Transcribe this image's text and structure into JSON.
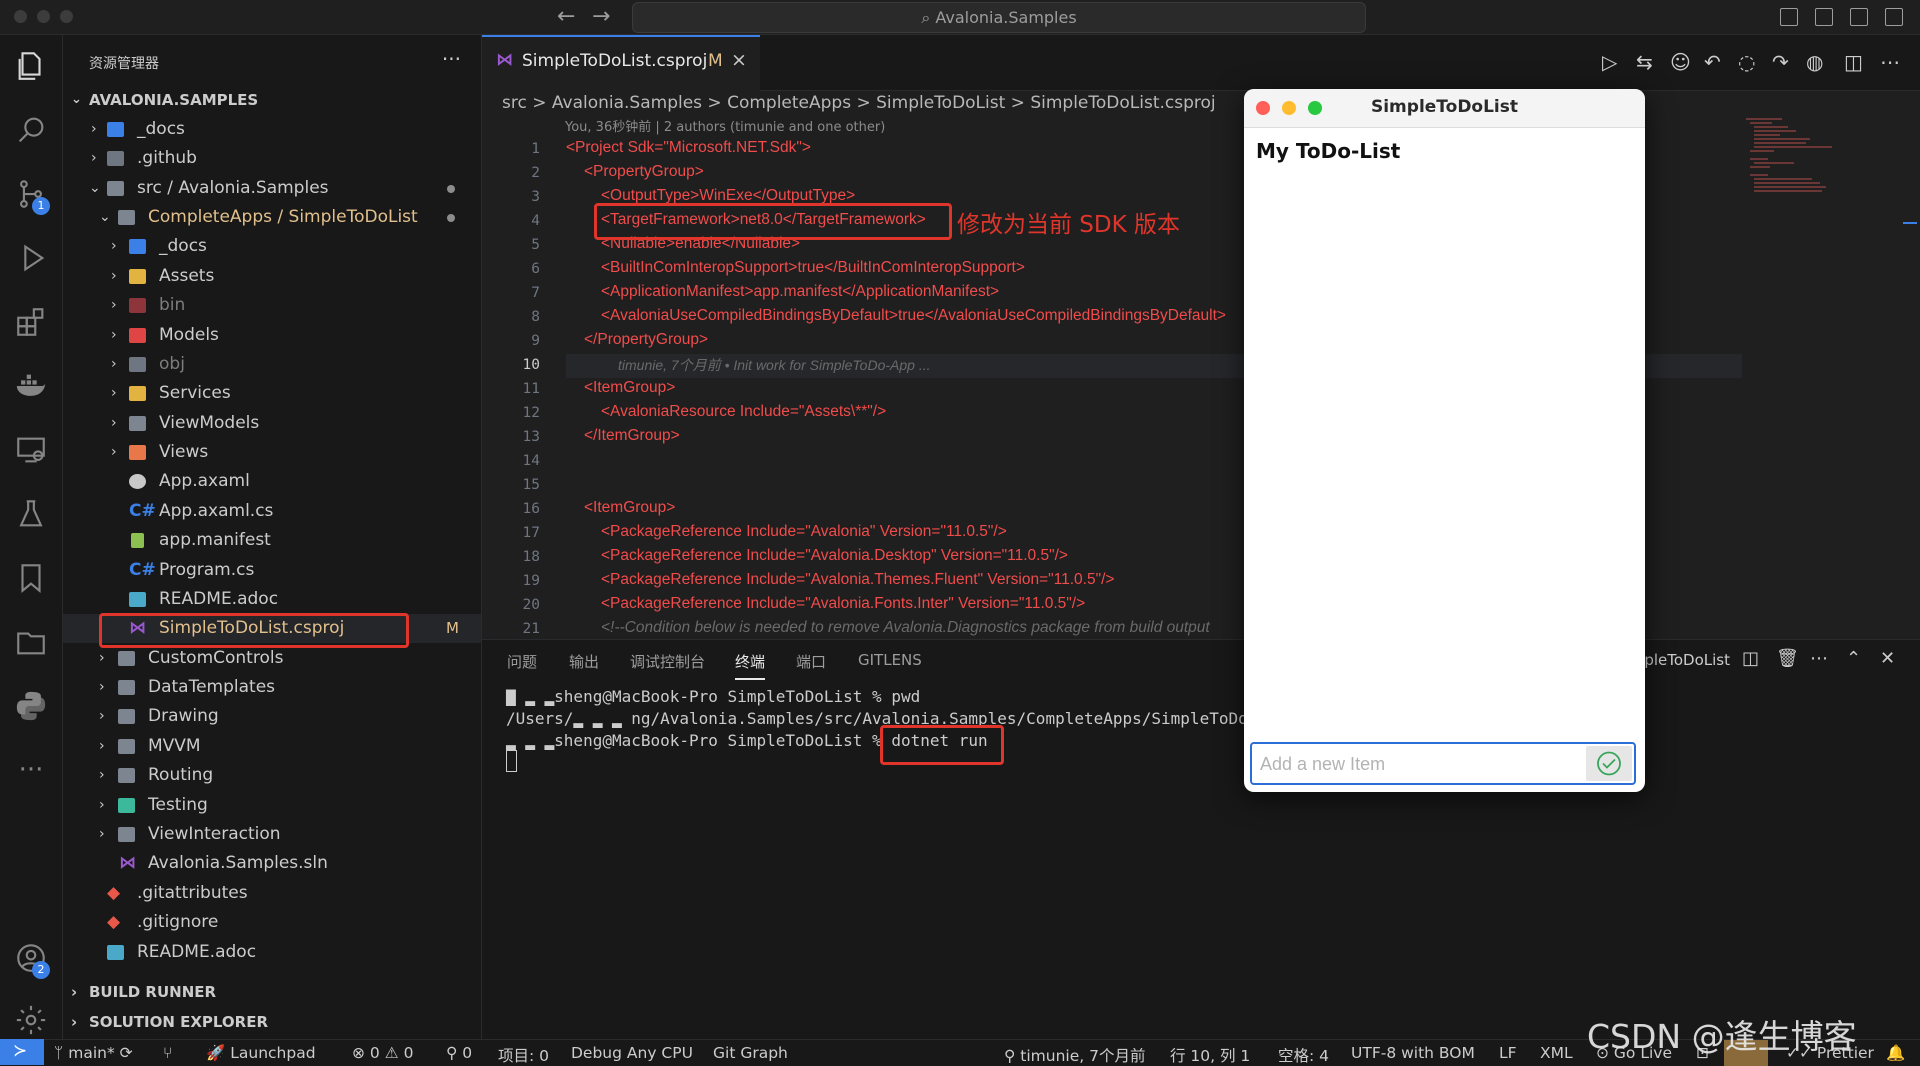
{
  "titlebar": {
    "search_text": "Avalonia.Samples"
  },
  "activity": {
    "scm_badge": "1",
    "accounts_badge": "2"
  },
  "sidebar": {
    "title": "资源管理器",
    "more": "···",
    "root": "AVALONIA.SAMPLES",
    "items": [
      {
        "label": "_docs"
      },
      {
        "label": ".github"
      },
      {
        "label": "src / Avalonia.Samples"
      },
      {
        "label": "CompleteApps / SimpleToDoList"
      },
      {
        "label": "_docs"
      },
      {
        "label": "Assets"
      },
      {
        "label": "bin"
      },
      {
        "label": "Models"
      },
      {
        "label": "obj"
      },
      {
        "label": "Services"
      },
      {
        "label": "ViewModels"
      },
      {
        "label": "Views"
      },
      {
        "label": "App.axaml"
      },
      {
        "label": "App.axaml.cs"
      },
      {
        "label": "app.manifest"
      },
      {
        "label": "Program.cs"
      },
      {
        "label": "README.adoc"
      },
      {
        "label": "SimpleToDoList.csproj",
        "status": "M"
      },
      {
        "label": "CustomControls"
      },
      {
        "label": "DataTemplates"
      },
      {
        "label": "Drawing"
      },
      {
        "label": "MVVM"
      },
      {
        "label": "Routing"
      },
      {
        "label": "Testing"
      },
      {
        "label": "ViewInteraction"
      },
      {
        "label": "Avalonia.Samples.sln"
      },
      {
        "label": ".gitattributes"
      },
      {
        "label": ".gitignore"
      },
      {
        "label": "README.adoc"
      }
    ],
    "sections": [
      "BUILD RUNNER",
      "SOLUTION EXPLORER"
    ]
  },
  "editor": {
    "tab_label": "SimpleToDoList.csproj",
    "tab_status": "M",
    "breadcrumb": "src > Avalonia.Samples > CompleteApps > SimpleToDoList > SimpleToDoList.csproj",
    "blame_header": "You, 36秒钟前 | 2 authors (timunie and one other)",
    "line_numbers": [
      "1",
      "2",
      "3",
      "4",
      "5",
      "6",
      "7",
      "8",
      "9",
      "10",
      "11",
      "12",
      "13",
      "14",
      "15",
      "16",
      "17",
      "18",
      "19",
      "20",
      "21"
    ],
    "lines": {
      "l1": "<Project Sdk=\"Microsoft.NET.Sdk\">",
      "l2": "<PropertyGroup>",
      "l3": "<OutputType>WinExe</OutputType>",
      "l4": "<TargetFramework>net8.0</TargetFramework>",
      "l5": "<Nullable>enable</Nullable>",
      "l6": "<BuiltInComInteropSupport>true</BuiltInComInteropSupport>",
      "l7": "<ApplicationManifest>app.manifest</ApplicationManifest>",
      "l8": "<AvaloniaUseCompiledBindingsByDefault>true</AvaloniaUseCompiledBindingsByDefault>",
      "l9": "</PropertyGroup>",
      "l10": "timunie, 7个月前 • Init work for SimpleToDo-App ...",
      "l11": "<ItemGroup>",
      "l12": "<AvaloniaResource Include=\"Assets\\**\"/>",
      "l13": "</ItemGroup>",
      "l16": "<ItemGroup>",
      "l17": "<PackageReference Include=\"Avalonia\" Version=\"11.0.5\"/>",
      "l18": "<PackageReference Include=\"Avalonia.Desktop\" Version=\"11.0.5\"/>",
      "l19": "<PackageReference Include=\"Avalonia.Themes.Fluent\" Version=\"11.0.5\"/>",
      "l20": "<PackageReference Include=\"Avalonia.Fonts.Inter\" Version=\"11.0.5\"/>",
      "l21": "<!--Condition below is needed to remove Avalonia.Diagnostics package from build output"
    },
    "annotation": "修改为当前 SDK 版本"
  },
  "panel": {
    "tabs": [
      "问题",
      "输出",
      "调试控制台",
      "终端",
      "端口",
      "GITLENS"
    ],
    "active_tab": "终端",
    "terminal_name": "SimpleToDoList",
    "terminal_lines": [
      "▇ ▂ ▂sheng@MacBook-Pro SimpleToDoList % pwd",
      "/Users/▂ ▂ ▂ ng/Avalonia.Samples/src/Avalonia.Samples/CompleteApps/SimpleToDoList",
      "▂ ▂ ▂sheng@MacBook-Pro SimpleToDoList % dotnet run"
    ]
  },
  "app_window": {
    "title": "SimpleToDoList",
    "heading": "My ToDo-List",
    "input_placeholder": "Add a new Item"
  },
  "statusbar": {
    "branch": "main*",
    "launchpad": "Launchpad",
    "errors": "0",
    "warnings": "0",
    "ports": "0",
    "project": "项目: 0",
    "debug": "Debug Any CPU",
    "git_graph": "Git Graph",
    "blame": "timunie, 7个月前",
    "position": "行 10, 列 1",
    "spaces": "空格: 4",
    "encoding": "UTF-8 with BOM",
    "eol": "LF",
    "language": "XML",
    "golive": "Go Live",
    "prettier": "Prettier"
  },
  "watermark": "CSDN @逢生博客",
  "colors": {
    "accent": "#3a80e6",
    "highlight_box": "#e0352b",
    "tag": "#f14c4c",
    "string": "#e2c08d"
  }
}
